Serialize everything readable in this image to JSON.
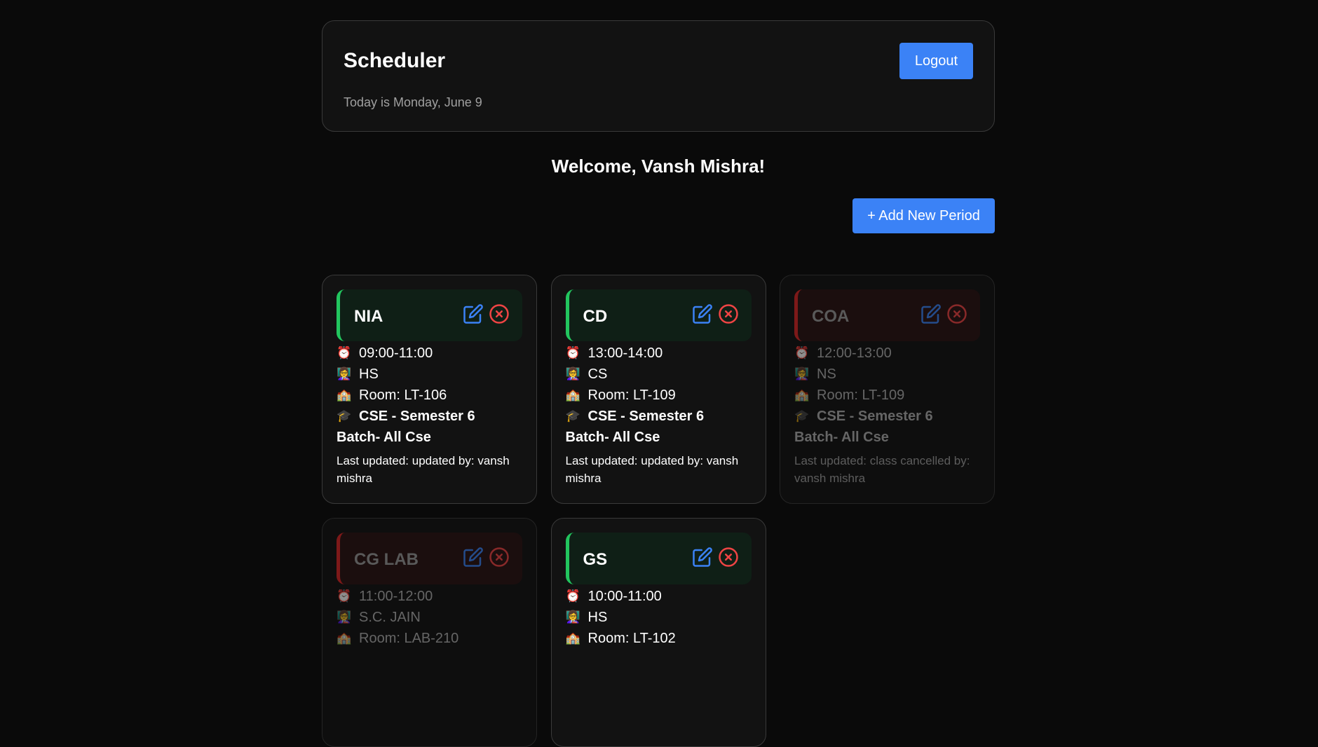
{
  "header": {
    "title": "Scheduler",
    "date_text": "Today is Monday, June 9",
    "logout_label": "Logout"
  },
  "welcome_text": "Welcome, Vansh Mishra!",
  "add_period_label": "+ Add New Period",
  "colors": {
    "accent": "#3b82f6",
    "active": "#22c55e",
    "cancelled": "#dc2626",
    "background": "#0a0a0a"
  },
  "icons": {
    "time": "alarm-clock-icon",
    "teacher": "teacher-icon",
    "room": "school-building-icon",
    "course": "graduation-cap-icon",
    "edit": "edit-icon",
    "cancel": "cancel-circle-icon"
  },
  "periods": [
    {
      "name": "NIA",
      "status": "active",
      "time": "09:00-11:00",
      "teacher": "HS",
      "room": "Room: LT-106",
      "course": "CSE - Semester 6",
      "batch": "Batch- All Cse",
      "last_updated": "Last updated: updated by: vansh mishra"
    },
    {
      "name": "CD",
      "status": "active",
      "time": "13:00-14:00",
      "teacher": "CS",
      "room": "Room: LT-109",
      "course": "CSE - Semester 6",
      "batch": "Batch- All Cse",
      "last_updated": "Last updated: updated by: vansh mishra"
    },
    {
      "name": "COA",
      "status": "cancelled",
      "time": "12:00-13:00",
      "teacher": "NS",
      "room": "Room: LT-109",
      "course": "CSE - Semester 6",
      "batch": "Batch- All Cse",
      "last_updated": "Last updated: class cancelled by: vansh mishra"
    },
    {
      "name": "CG LAB",
      "status": "cancelled",
      "time": "11:00-12:00",
      "teacher": "S.C. JAIN",
      "room": "Room: LAB-210",
      "course": "",
      "batch": "",
      "last_updated": ""
    },
    {
      "name": "GS",
      "status": "active",
      "time": "10:00-11:00",
      "teacher": "HS",
      "room": "Room: LT-102",
      "course": "",
      "batch": "",
      "last_updated": ""
    }
  ]
}
